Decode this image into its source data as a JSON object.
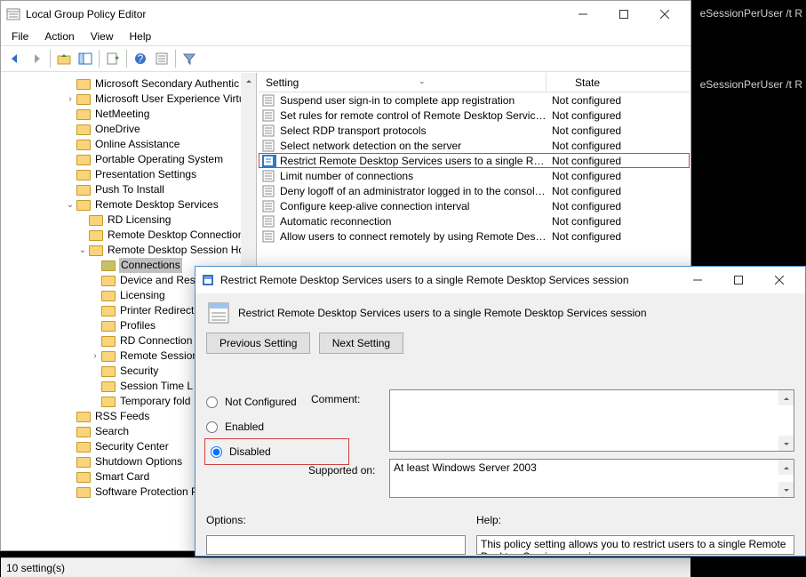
{
  "cmd_overlay": {
    "line1": "eSessionPerUser /t R",
    "line2": "eSessionPerUser /t R"
  },
  "gp": {
    "title": "Local Group Policy Editor",
    "menu": [
      "File",
      "Action",
      "View",
      "Help"
    ],
    "status": "10 setting(s)",
    "tree": [
      {
        "indent": 5,
        "label": "Microsoft Secondary Authentic"
      },
      {
        "indent": 5,
        "label": "Microsoft User Experience Virtu",
        "twisty": ">"
      },
      {
        "indent": 5,
        "label": "NetMeeting"
      },
      {
        "indent": 5,
        "label": "OneDrive"
      },
      {
        "indent": 5,
        "label": "Online Assistance"
      },
      {
        "indent": 5,
        "label": "Portable Operating System"
      },
      {
        "indent": 5,
        "label": "Presentation Settings"
      },
      {
        "indent": 5,
        "label": "Push To Install"
      },
      {
        "indent": 5,
        "label": "Remote Desktop Services",
        "twisty": "v"
      },
      {
        "indent": 6,
        "label": "RD Licensing"
      },
      {
        "indent": 6,
        "label": "Remote Desktop Connection"
      },
      {
        "indent": 6,
        "label": "Remote Desktop Session Ho",
        "twisty": "v"
      },
      {
        "indent": 7,
        "label": "Connections",
        "selected": true
      },
      {
        "indent": 7,
        "label": "Device and Res"
      },
      {
        "indent": 7,
        "label": "Licensing"
      },
      {
        "indent": 7,
        "label": "Printer Redirect"
      },
      {
        "indent": 7,
        "label": "Profiles"
      },
      {
        "indent": 7,
        "label": "RD Connection"
      },
      {
        "indent": 7,
        "label": "Remote Session",
        "twisty": ">"
      },
      {
        "indent": 7,
        "label": "Security"
      },
      {
        "indent": 7,
        "label": "Session Time L"
      },
      {
        "indent": 7,
        "label": "Temporary fold"
      },
      {
        "indent": 5,
        "label": "RSS Feeds"
      },
      {
        "indent": 5,
        "label": "Search"
      },
      {
        "indent": 5,
        "label": "Security Center"
      },
      {
        "indent": 5,
        "label": "Shutdown Options"
      },
      {
        "indent": 5,
        "label": "Smart Card"
      },
      {
        "indent": 5,
        "label": "Software Protection Pl"
      }
    ],
    "columns": {
      "setting": "Setting",
      "state": "State"
    },
    "rows": [
      {
        "name": "Suspend user sign-in to complete app registration",
        "state": "Not configured"
      },
      {
        "name": "Set rules for remote control of Remote Desktop Services use...",
        "state": "Not configured"
      },
      {
        "name": "Select RDP transport protocols",
        "state": "Not configured"
      },
      {
        "name": "Select network detection on the server",
        "state": "Not configured"
      },
      {
        "name": "Restrict Remote Desktop Services users to a single Remote D...",
        "state": "Not configured",
        "hl": true,
        "sel": true
      },
      {
        "name": "Limit number of connections",
        "state": "Not configured"
      },
      {
        "name": "Deny logoff of an administrator logged in to the console ses...",
        "state": "Not configured"
      },
      {
        "name": "Configure keep-alive connection interval",
        "state": "Not configured"
      },
      {
        "name": "Automatic reconnection",
        "state": "Not configured"
      },
      {
        "name": "Allow users to connect remotely by using Remote Desktop S...",
        "state": "Not configured"
      }
    ]
  },
  "dialog": {
    "title": "Restrict Remote Desktop Services users to a single Remote Desktop Services session",
    "heading": "Restrict Remote Desktop Services users to a single Remote Desktop Services session",
    "prev": "Previous Setting",
    "next": "Next Setting",
    "radios": {
      "nc": "Not Configured",
      "en": "Enabled",
      "dis": "Disabled"
    },
    "selected_radio": "Disabled",
    "comment_label": "Comment:",
    "supported_label": "Supported on:",
    "supported_text": "At least Windows Server 2003",
    "options_label": "Options:",
    "help_label": "Help:",
    "help_text": "This policy setting allows you to restrict users to a single Remote Desktop Services session."
  }
}
